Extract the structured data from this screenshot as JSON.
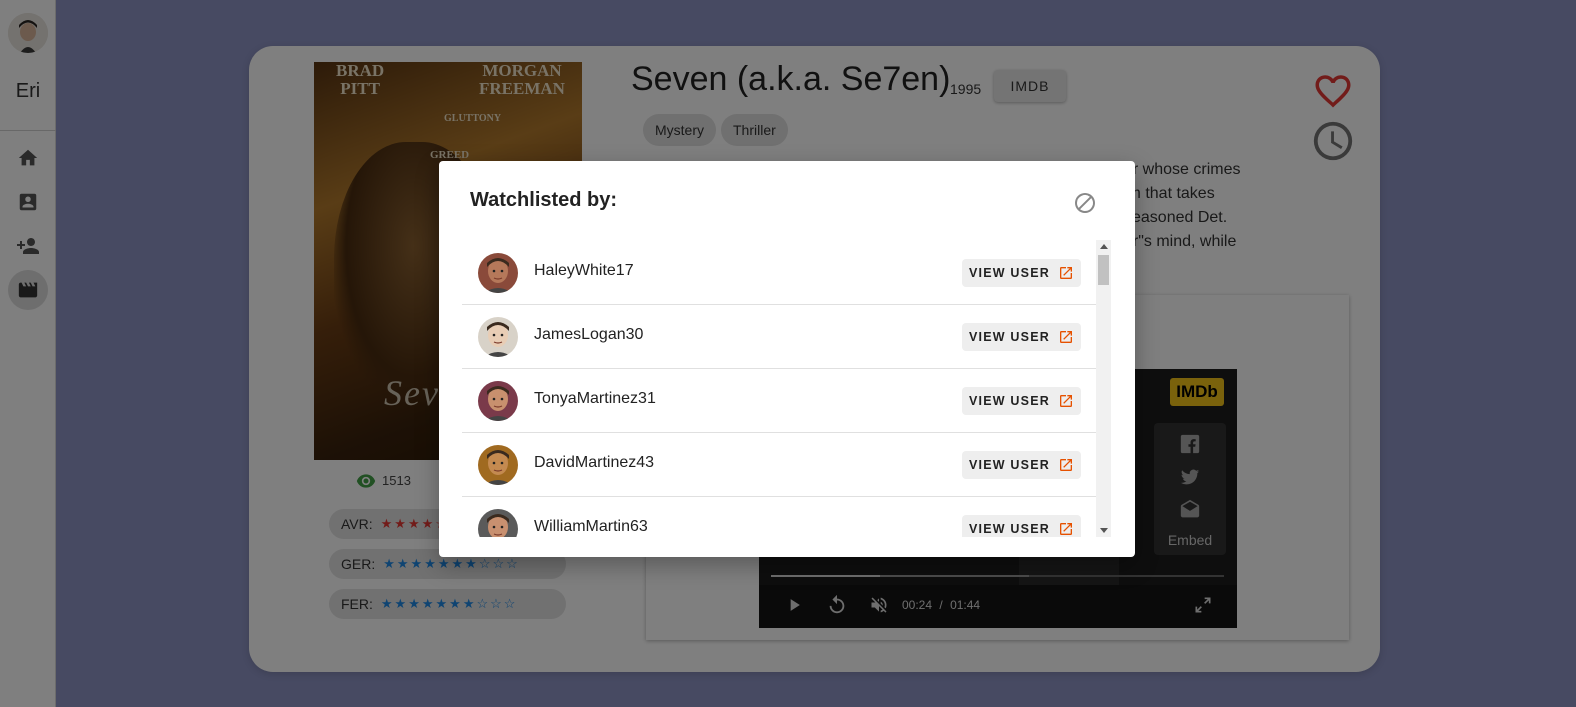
{
  "sidebar": {
    "user_name": "Eri",
    "items": [
      {
        "icon": "home-icon"
      },
      {
        "icon": "account-box-icon"
      },
      {
        "icon": "person-add-icon"
      },
      {
        "icon": "movie-icon",
        "active": true
      }
    ]
  },
  "movie": {
    "title": "Seven (a.k.a. Se7en)",
    "year": "1995",
    "imdb_button": "IMDB",
    "genres": [
      "Mystery",
      "Thriller"
    ],
    "description_lines": [
      "er whose crimes",
      "lm that takes",
      "seasoned Det.",
      "er\"s mind, while",
      "."
    ],
    "poster": {
      "actor1": "BRAD\nPITT",
      "actor2": "MORGAN\nFREEMAN",
      "words": [
        "GLUTTONY",
        "GREED"
      ],
      "logo": "Seven"
    },
    "views": "1513",
    "ratings": [
      {
        "label": "AVR:",
        "filled": 4,
        "total": 10,
        "color": "#e53935"
      },
      {
        "label": "GER:",
        "filled": 7,
        "total": 10,
        "color": "#1e88e5"
      },
      {
        "label": "FER:",
        "filled": 7,
        "total": 10,
        "color": "#1e88e5"
      }
    ]
  },
  "video": {
    "imdb_logo": "IMDb",
    "embed_label": "Embed",
    "current_time": "00:24",
    "separator": "/",
    "duration": "01:44",
    "progress": 0.24,
    "buffered": 0.57
  },
  "dialog": {
    "title": "Watchlisted by:",
    "view_label": "VIEW USER",
    "users": [
      {
        "name": "HaleyWhite17",
        "skin": "#b5785a",
        "bg": "#8a4a3a"
      },
      {
        "name": "JamesLogan30",
        "skin": "#e8cdb5",
        "bg": "#d8d2c8"
      },
      {
        "name": "TonyaMartinez31",
        "skin": "#c8906e",
        "bg": "#7a3a4a"
      },
      {
        "name": "DavidMartinez43",
        "skin": "#c48a50",
        "bg": "#a06a20"
      },
      {
        "name": "WilliamMartin63",
        "skin": "#c89070",
        "bg": "#5a5a5a"
      }
    ]
  }
}
